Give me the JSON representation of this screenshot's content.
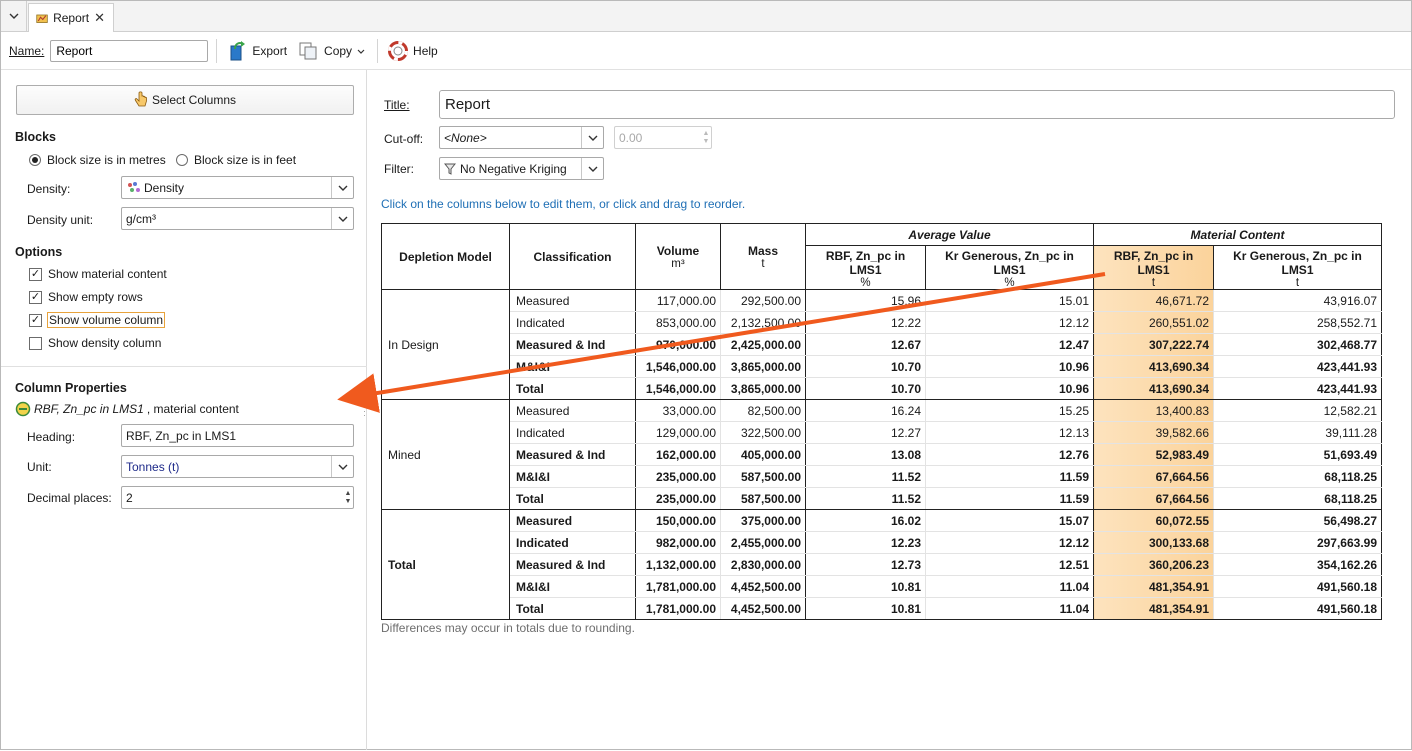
{
  "tab": {
    "title": "Report",
    "close": "✕"
  },
  "toolbar": {
    "name_label": "Name:",
    "name_value": "Report",
    "export": "Export",
    "copy": "Copy",
    "help": "Help"
  },
  "left": {
    "select_columns": "Select Columns",
    "blocks_heading": "Blocks",
    "block_metres": "Block size is in metres",
    "block_feet": "Block size is in feet",
    "block_metres_selected": true,
    "density_label": "Density:",
    "density_value": "Density",
    "density_unit_label": "Density unit:",
    "density_unit_value": "g/cm³",
    "options_heading": "Options",
    "options": [
      {
        "label": "Show material content",
        "checked": true
      },
      {
        "label": "Show empty rows",
        "checked": true
      },
      {
        "label": "Show volume column",
        "checked": true
      },
      {
        "label": "Show density column",
        "checked": false
      }
    ],
    "colprops_heading": "Column Properties",
    "colprops_item_italic": "RBF, Zn_pc in LMS1",
    "colprops_item_rest": ", material content",
    "heading_label": "Heading:",
    "heading_value": "RBF, Zn_pc in LMS1",
    "unit_label": "Unit:",
    "unit_value": "Tonnes (t)",
    "decimal_label": "Decimal places:",
    "decimal_value": "2"
  },
  "right": {
    "title_label": "Title:",
    "title_value": "Report",
    "cutoff_label": "Cut-off:",
    "cutoff_value": "<None>",
    "cutoff_number": "0.00",
    "filter_label": "Filter:",
    "filter_value": "No Negative Kriging",
    "hint": "Click on the columns below to edit them, or click and drag to reorder.",
    "footnote": "Differences may occur in totals due to rounding."
  },
  "table": {
    "group_avg": "Average Value",
    "group_mc": "Material Content",
    "headers": [
      {
        "name": "Depletion Model",
        "unit": ""
      },
      {
        "name": "Classification",
        "unit": ""
      },
      {
        "name": "Volume",
        "unit": "m³"
      },
      {
        "name": "Mass",
        "unit": "t"
      },
      {
        "name": "RBF, Zn_pc in LMS1",
        "unit": "%"
      },
      {
        "name": "Kr Generous, Zn_pc in LMS1",
        "unit": "%"
      },
      {
        "name": "RBF, Zn_pc in LMS1",
        "unit": "t"
      },
      {
        "name": "Kr Generous, Zn_pc in LMS1",
        "unit": "t"
      }
    ],
    "groups": [
      {
        "name": "In Design",
        "rows": [
          {
            "cls": "Measured",
            "bold": false,
            "vals": [
              "117,000.00",
              "292,500.00",
              "15.96",
              "15.01",
              "46,671.72",
              "43,916.07"
            ]
          },
          {
            "cls": "Indicated",
            "bold": false,
            "vals": [
              "853,000.00",
              "2,132,500.00",
              "12.22",
              "12.12",
              "260,551.02",
              "258,552.71"
            ]
          },
          {
            "cls": "Measured & Ind",
            "bold": true,
            "vals": [
              "970,000.00",
              "2,425,000.00",
              "12.67",
              "12.47",
              "307,222.74",
              "302,468.77"
            ]
          },
          {
            "cls": "M&I&I",
            "bold": true,
            "vals": [
              "1,546,000.00",
              "3,865,000.00",
              "10.70",
              "10.96",
              "413,690.34",
              "423,441.93"
            ]
          },
          {
            "cls": "Total",
            "bold": true,
            "vals": [
              "1,546,000.00",
              "3,865,000.00",
              "10.70",
              "10.96",
              "413,690.34",
              "423,441.93"
            ]
          }
        ]
      },
      {
        "name": "Mined",
        "rows": [
          {
            "cls": "Measured",
            "bold": false,
            "vals": [
              "33,000.00",
              "82,500.00",
              "16.24",
              "15.25",
              "13,400.83",
              "12,582.21"
            ]
          },
          {
            "cls": "Indicated",
            "bold": false,
            "vals": [
              "129,000.00",
              "322,500.00",
              "12.27",
              "12.13",
              "39,582.66",
              "39,111.28"
            ]
          },
          {
            "cls": "Measured & Ind",
            "bold": true,
            "vals": [
              "162,000.00",
              "405,000.00",
              "13.08",
              "12.76",
              "52,983.49",
              "51,693.49"
            ]
          },
          {
            "cls": "M&I&I",
            "bold": true,
            "vals": [
              "235,000.00",
              "587,500.00",
              "11.52",
              "11.59",
              "67,664.56",
              "68,118.25"
            ]
          },
          {
            "cls": "Total",
            "bold": true,
            "vals": [
              "235,000.00",
              "587,500.00",
              "11.52",
              "11.59",
              "67,664.56",
              "68,118.25"
            ]
          }
        ]
      },
      {
        "name": "Total",
        "rows": [
          {
            "cls": "Measured",
            "bold": true,
            "vals": [
              "150,000.00",
              "375,000.00",
              "16.02",
              "15.07",
              "60,072.55",
              "56,498.27"
            ]
          },
          {
            "cls": "Indicated",
            "bold": true,
            "vals": [
              "982,000.00",
              "2,455,000.00",
              "12.23",
              "12.12",
              "300,133.68",
              "297,663.99"
            ]
          },
          {
            "cls": "Measured & Ind",
            "bold": true,
            "vals": [
              "1,132,000.00",
              "2,830,000.00",
              "12.73",
              "12.51",
              "360,206.23",
              "354,162.26"
            ]
          },
          {
            "cls": "M&I&I",
            "bold": true,
            "vals": [
              "1,781,000.00",
              "4,452,500.00",
              "10.81",
              "11.04",
              "481,354.91",
              "491,560.18"
            ]
          },
          {
            "cls": "Total",
            "bold": true,
            "vals": [
              "1,781,000.00",
              "4,452,500.00",
              "10.81",
              "11.04",
              "481,354.91",
              "491,560.18"
            ]
          }
        ]
      }
    ]
  },
  "colors": {
    "accent_arrow": "#f05a1e",
    "selected_column": "#fbd39b",
    "hint_text": "#1f6fb5"
  },
  "icons": [
    "chevron-down-icon",
    "report-icon",
    "close-icon",
    "export-icon",
    "copy-icon",
    "help-icon",
    "hand-pointer-icon",
    "density-icon",
    "grade-attribute-icon",
    "filter-icon"
  ]
}
